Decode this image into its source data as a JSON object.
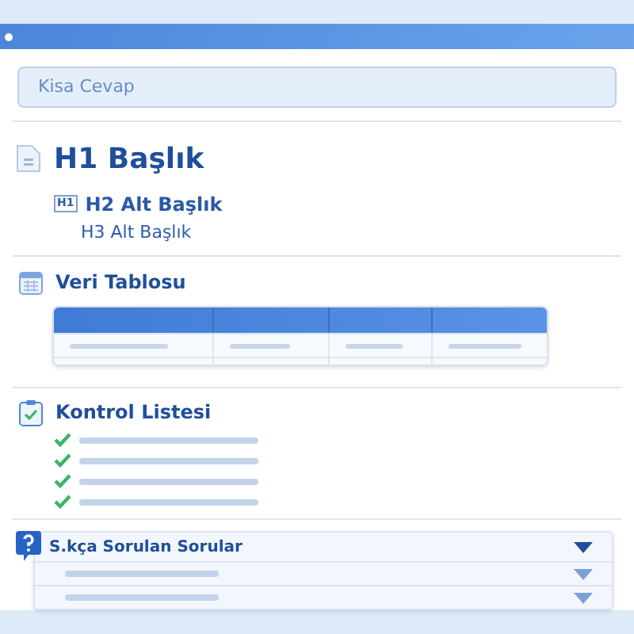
{
  "answer_field": {
    "placeholder": "Kisa Cevap"
  },
  "headings": {
    "h1": "H1 Başlık",
    "h2_badge": "H1",
    "h2": "H2 Alt Başlık",
    "h3": "H3 Alt Başlık"
  },
  "table": {
    "title": "Veri Tablosu"
  },
  "checklist": {
    "title": "Kontrol Listesi",
    "items": [
      {
        "checked": true
      },
      {
        "checked": true
      },
      {
        "checked": true
      },
      {
        "checked": true
      }
    ]
  },
  "faq": {
    "title": "S.kça Sorulan Sorular",
    "expanded": false,
    "items": [
      {
        "expanded": false
      },
      {
        "expanded": false
      }
    ]
  }
}
